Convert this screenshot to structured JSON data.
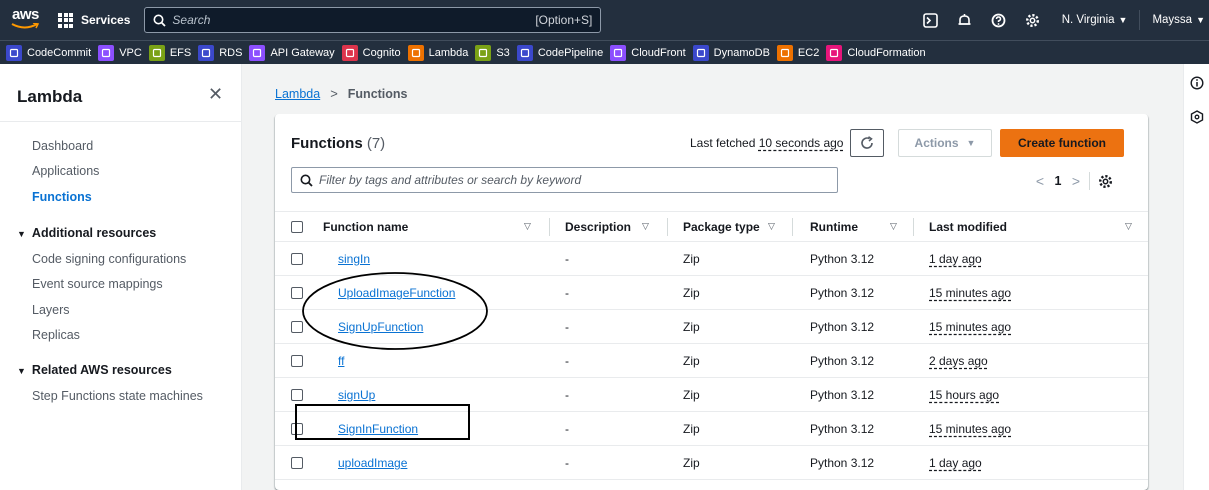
{
  "topbar": {
    "logo_text": "aws",
    "services_label": "Services",
    "search_placeholder": "Search",
    "search_shortcut": "[Option+S]",
    "region": "N. Virginia",
    "user": "Mayssa",
    "caret": "▼"
  },
  "favorites": [
    {
      "label": "CodeCommit",
      "color": "#3b48cc"
    },
    {
      "label": "VPC",
      "color": "#8c4fff"
    },
    {
      "label": "EFS",
      "color": "#7aa116"
    },
    {
      "label": "RDS",
      "color": "#3b48cc"
    },
    {
      "label": "API Gateway",
      "color": "#8c4fff"
    },
    {
      "label": "Cognito",
      "color": "#dd344c"
    },
    {
      "label": "Lambda",
      "color": "#ed7100"
    },
    {
      "label": "S3",
      "color": "#7aa116"
    },
    {
      "label": "CodePipeline",
      "color": "#3b48cc"
    },
    {
      "label": "CloudFront",
      "color": "#8c4fff"
    },
    {
      "label": "DynamoDB",
      "color": "#3b48cc"
    },
    {
      "label": "EC2",
      "color": "#ed7100"
    },
    {
      "label": "CloudFormation",
      "color": "#e7157b"
    }
  ],
  "sidebar": {
    "title": "Lambda",
    "close": "✕",
    "links": [
      "Dashboard",
      "Applications",
      "Functions"
    ],
    "section1": {
      "title": "Additional resources",
      "links": [
        "Code signing configurations",
        "Event source mappings",
        "Layers",
        "Replicas"
      ]
    },
    "section2": {
      "title": "Related AWS resources",
      "links": [
        "Step Functions state machines"
      ]
    },
    "tri": "▼"
  },
  "breadcrumb": {
    "root": "Lambda",
    "sep": ">",
    "current": "Functions"
  },
  "panel": {
    "title": "Functions",
    "count": "(7)",
    "last_fetched_prefix": "Last fetched",
    "last_fetched_ago": "10 seconds ago",
    "actions_label": "Actions",
    "create_label": "Create function",
    "filter_placeholder": "Filter by tags and attributes or search by keyword",
    "page": "1",
    "prev": "<",
    "next": ">"
  },
  "table": {
    "headers": [
      "Function name",
      "Description",
      "Package type",
      "Runtime",
      "Last modified"
    ],
    "sort_icon": "▽",
    "rows": [
      {
        "name": "singIn",
        "description": "-",
        "package": "Zip",
        "runtime": "Python 3.12",
        "modified": "1 day ago"
      },
      {
        "name": "UploadImageFunction",
        "description": "-",
        "package": "Zip",
        "runtime": "Python 3.12",
        "modified": "15 minutes ago"
      },
      {
        "name": "SignUpFunction",
        "description": "-",
        "package": "Zip",
        "runtime": "Python 3.12",
        "modified": "15 minutes ago"
      },
      {
        "name": "ff",
        "description": "-",
        "package": "Zip",
        "runtime": "Python 3.12",
        "modified": "2 days ago"
      },
      {
        "name": "signUp",
        "description": "-",
        "package": "Zip",
        "runtime": "Python 3.12",
        "modified": "15 hours ago"
      },
      {
        "name": "SignInFunction",
        "description": "-",
        "package": "Zip",
        "runtime": "Python 3.12",
        "modified": "15 minutes ago"
      },
      {
        "name": "uploadImage",
        "description": "-",
        "package": "Zip",
        "runtime": "Python 3.12",
        "modified": "1 day ago"
      }
    ]
  }
}
